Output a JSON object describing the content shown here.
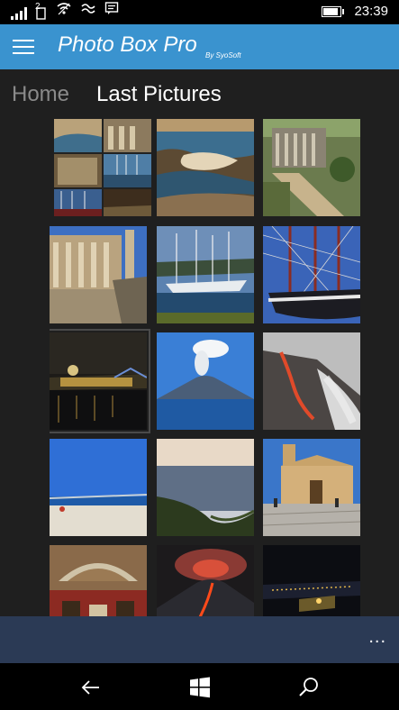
{
  "status": {
    "time": "23:39",
    "sim_glyph": "2",
    "icons": [
      "signal-icon",
      "sim-icon",
      "wifi-icon",
      "data-sense-icon",
      "message-icon",
      "battery-icon"
    ]
  },
  "header": {
    "title": "Photo Box Pro",
    "subtitle": "By SyoSoft",
    "color": "#3a93cf"
  },
  "pivot": {
    "items": [
      {
        "label": "Home",
        "active": false
      },
      {
        "label": "Last Pictures",
        "active": true
      }
    ]
  },
  "grid": {
    "columns": 3,
    "photos": [
      {
        "name": "collage"
      },
      {
        "name": "coast-rocks"
      },
      {
        "name": "ancient-ruins"
      },
      {
        "name": "library-ruins"
      },
      {
        "name": "harbor-sailboats"
      },
      {
        "name": "tall-ship-masts"
      },
      {
        "name": "night-city-river",
        "selected": true
      },
      {
        "name": "volcano-island"
      },
      {
        "name": "lava-flow"
      },
      {
        "name": "beach-blue-sky"
      },
      {
        "name": "sea-cliffs-sunset"
      },
      {
        "name": "church-square"
      },
      {
        "name": "museum-interior"
      },
      {
        "name": "erupting-volcano"
      },
      {
        "name": "night-coastline"
      }
    ]
  },
  "app_bar": {
    "more_label": "..."
  },
  "nav": {
    "buttons": [
      "back-icon",
      "windows-icon",
      "search-icon"
    ]
  }
}
